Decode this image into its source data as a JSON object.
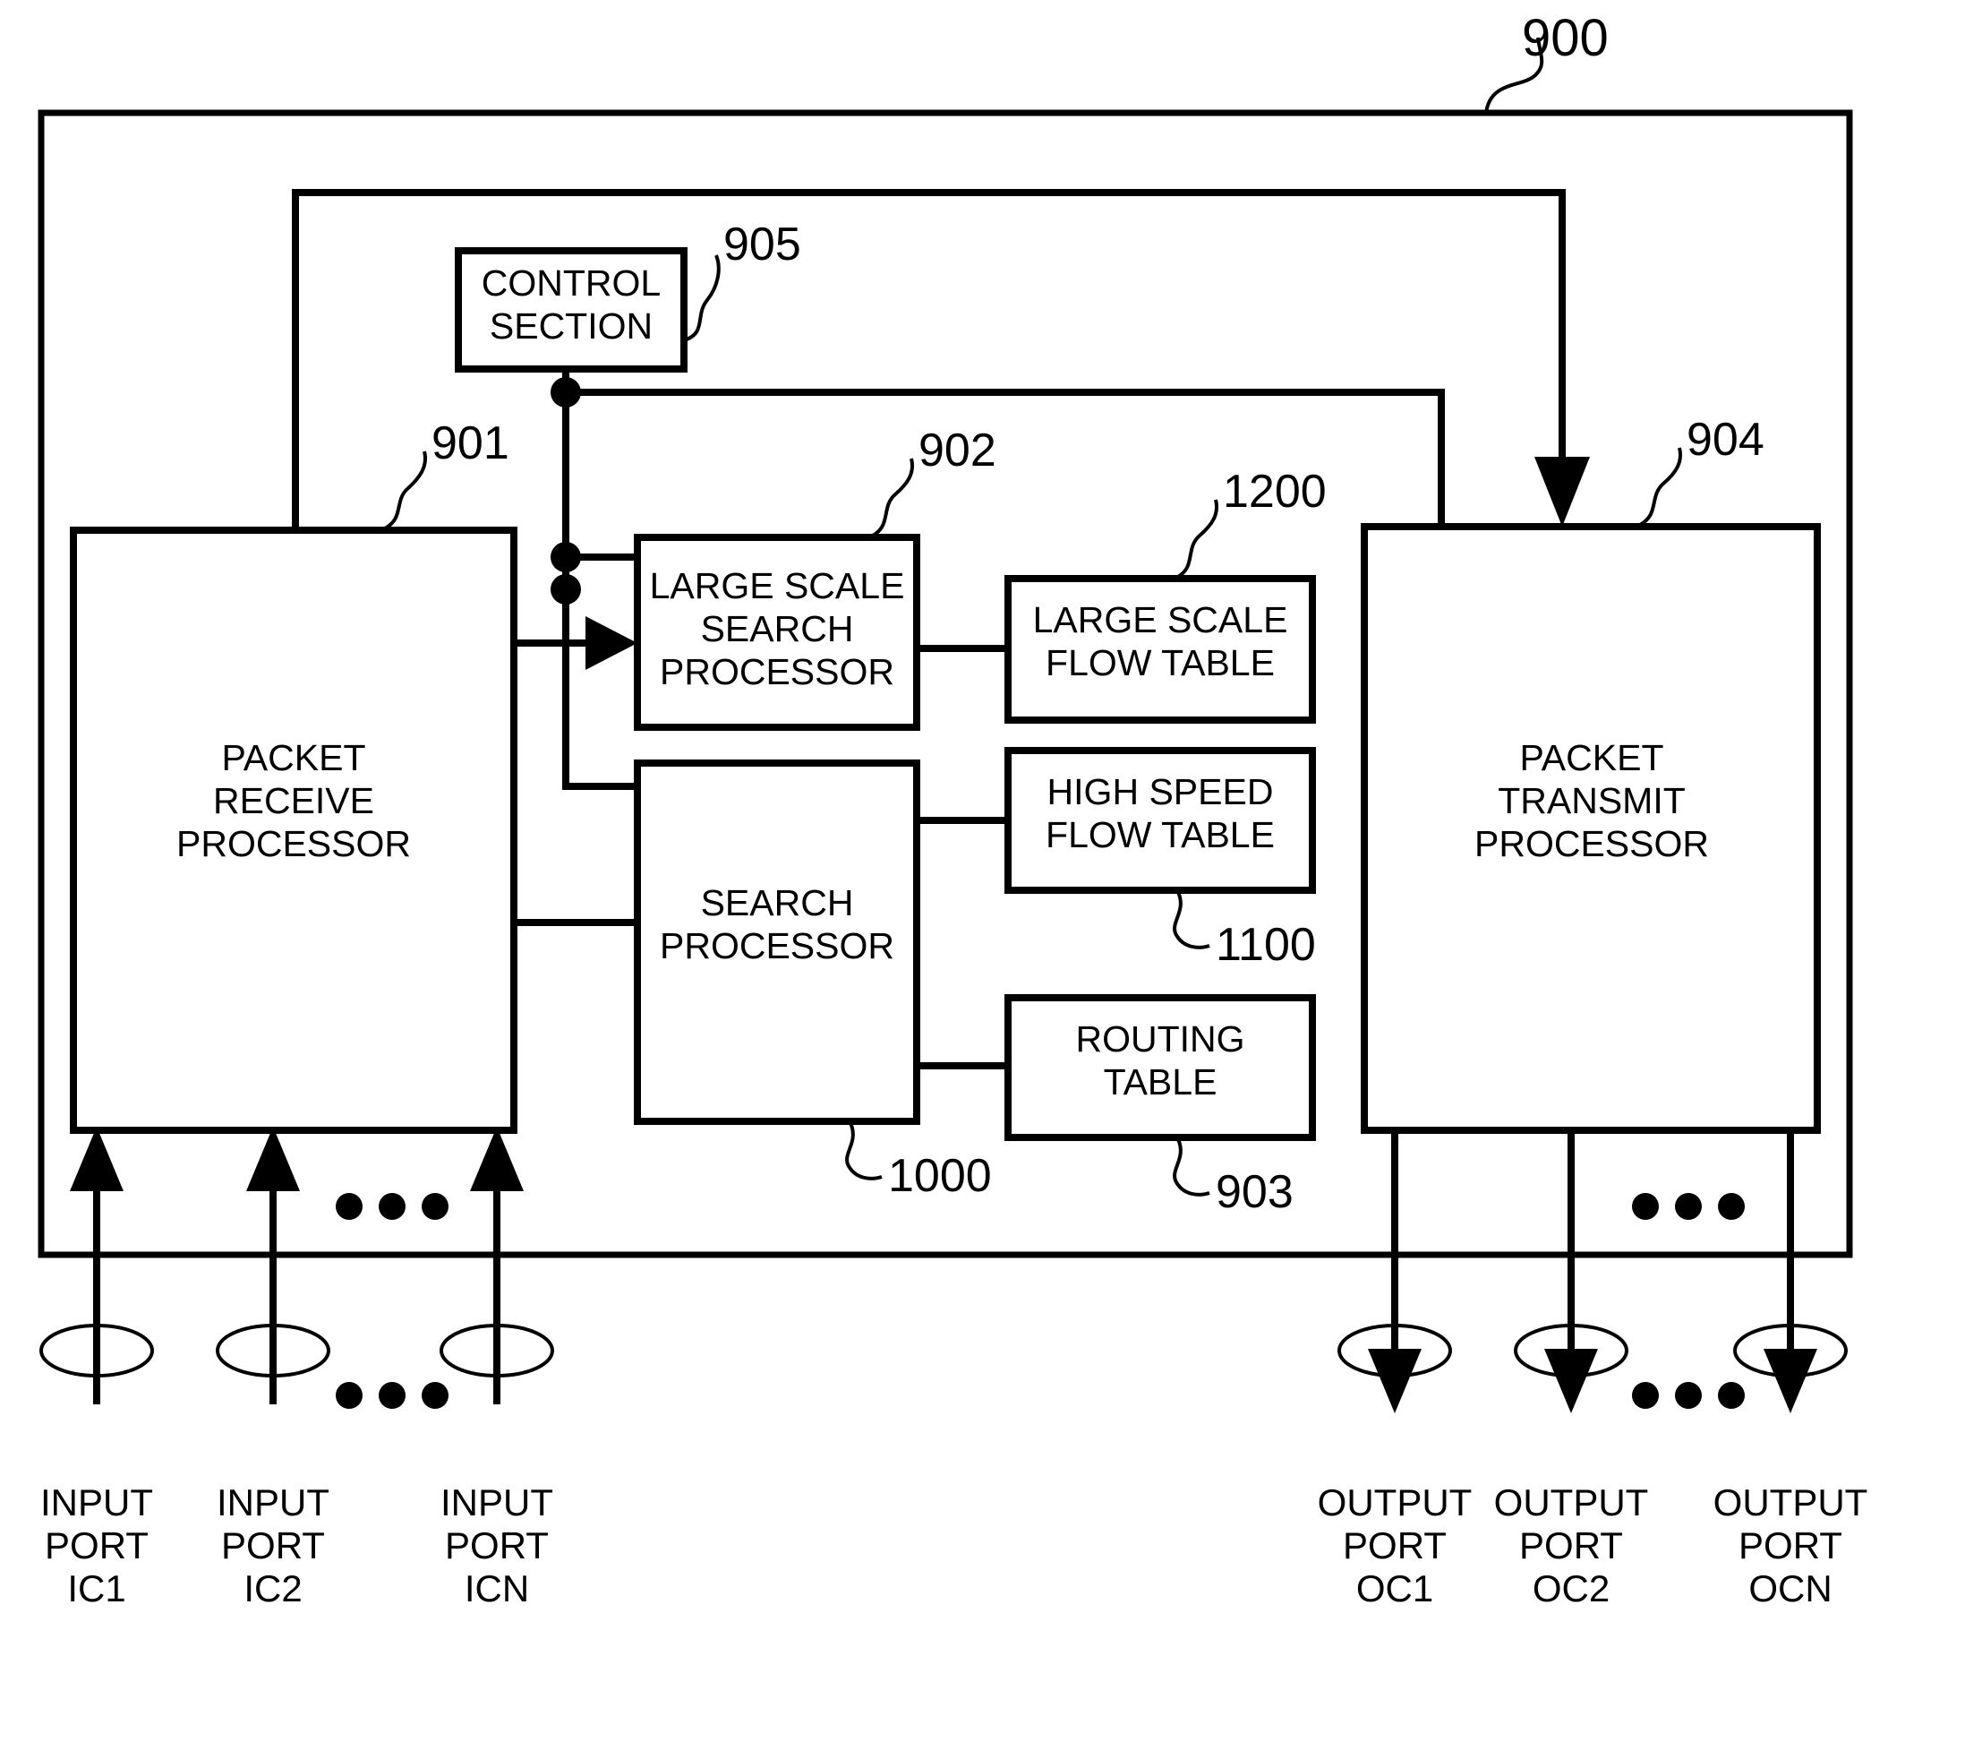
{
  "figure": {
    "type": "patent-block-diagram",
    "outer_reference": "900"
  },
  "blocks": {
    "control_section": {
      "label_line1": "CONTROL",
      "label_line2": "SECTION",
      "ref": "905"
    },
    "packet_receive_processor": {
      "label_line1": "PACKET",
      "label_line2": "RECEIVE",
      "label_line3": "PROCESSOR",
      "ref": "901"
    },
    "large_scale_search_processor": {
      "label_line1": "LARGE SCALE",
      "label_line2": "SEARCH",
      "label_line3": "PROCESSOR",
      "ref": "902"
    },
    "search_processor": {
      "label_line1": "SEARCH",
      "label_line2": "PROCESSOR",
      "ref": "1000"
    },
    "large_scale_flow_table": {
      "label_line1": "LARGE SCALE",
      "label_line2": "FLOW TABLE",
      "ref": "1200"
    },
    "high_speed_flow_table": {
      "label_line1": "HIGH SPEED",
      "label_line2": "FLOW TABLE",
      "ref": "1100"
    },
    "routing_table": {
      "label_line1": "ROUTING",
      "label_line2": "TABLE",
      "ref": "903"
    },
    "packet_transmit_processor": {
      "label_line1": "PACKET",
      "label_line2": "TRANSMIT",
      "label_line3": "PROCESSOR",
      "ref": "904"
    }
  },
  "input_ports": [
    {
      "line1": "INPUT",
      "line2": "PORT",
      "line3": "IC1"
    },
    {
      "line1": "INPUT",
      "line2": "PORT",
      "line3": "IC2"
    },
    {
      "line1": "INPUT",
      "line2": "PORT",
      "line3": "ICN"
    }
  ],
  "output_ports": [
    {
      "line1": "OUTPUT",
      "line2": "PORT",
      "line3": "OC1"
    },
    {
      "line1": "OUTPUT",
      "line2": "PORT",
      "line3": "OC2"
    },
    {
      "line1": "OUTPUT",
      "line2": "PORT",
      "line3": "OCN"
    }
  ],
  "ellipsis": {
    "glyph": "• • •"
  },
  "colors": {
    "ink": "#000000",
    "paper": "#ffffff"
  }
}
